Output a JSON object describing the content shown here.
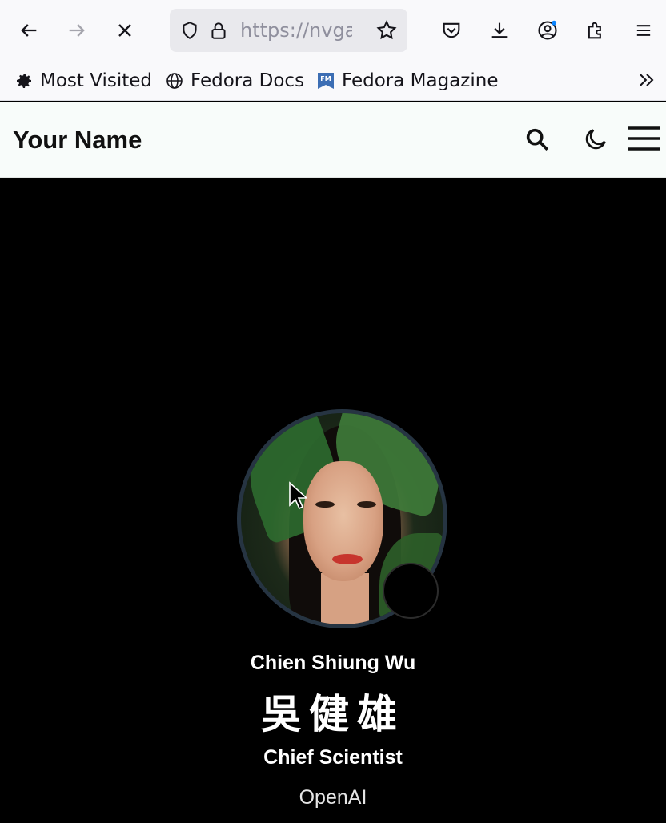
{
  "browser": {
    "url_text": "https://nvga",
    "bookmarks": [
      {
        "label": "Most Visited",
        "icon": "gear-icon"
      },
      {
        "label": "Fedora Docs",
        "icon": "globe-icon"
      },
      {
        "label": "Fedora Magazine",
        "icon": "fedora-magazine-icon"
      }
    ],
    "fm_badge": "FM"
  },
  "site": {
    "brand": "Your Name",
    "accent": "#263442"
  },
  "profile": {
    "name_en": "Chien Shiung Wu",
    "name_zh": "吳健雄",
    "role": "Chief Scientist",
    "organization": "OpenAI",
    "status_emoji": "☕"
  }
}
